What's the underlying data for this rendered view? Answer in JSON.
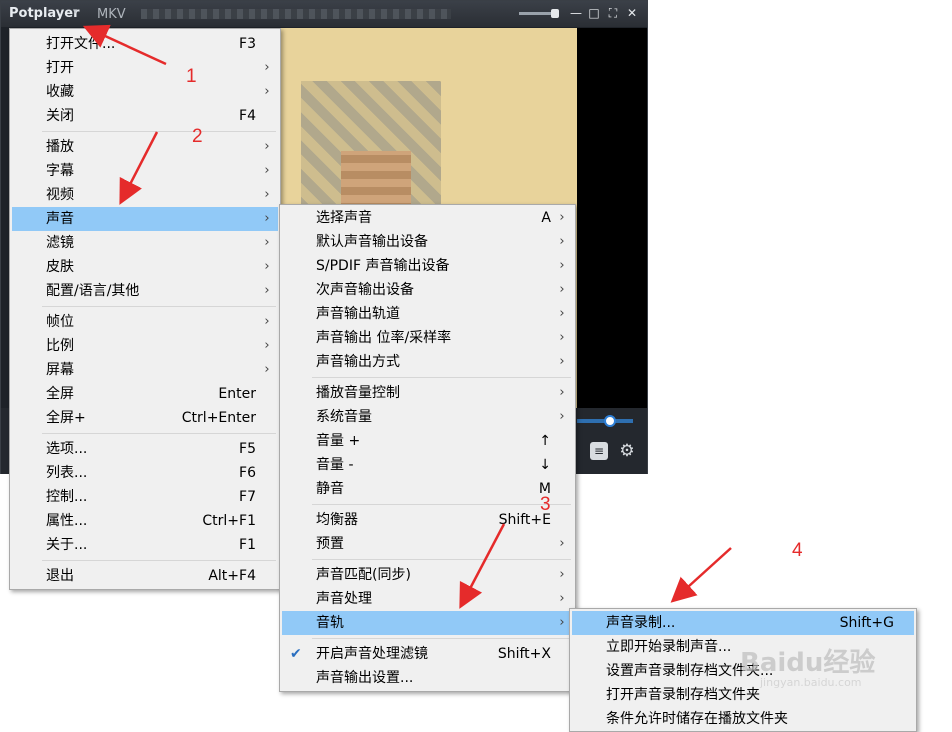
{
  "player": {
    "brand": "Potplayer",
    "format": "MKV",
    "window_buttons": [
      "—",
      "□",
      "⛶",
      "✕"
    ],
    "menu_caret": "▾"
  },
  "menu_main": {
    "items": [
      {
        "label": "打开文件...",
        "shortcut": "F3"
      },
      {
        "label": "打开",
        "submenu": true
      },
      {
        "label": "收藏",
        "submenu": true
      },
      {
        "label": "关闭",
        "shortcut": "F4"
      },
      {
        "label": "播放",
        "submenu": true
      },
      {
        "label": "字幕",
        "submenu": true
      },
      {
        "label": "视频",
        "submenu": true
      },
      {
        "label": "声音",
        "submenu": true,
        "highlighted": true
      },
      {
        "label": "滤镜",
        "submenu": true
      },
      {
        "label": "皮肤",
        "submenu": true
      },
      {
        "label": "配置/语言/其他",
        "submenu": true
      },
      {
        "label": "帧位",
        "submenu": true
      },
      {
        "label": "比例",
        "submenu": true
      },
      {
        "label": "屏幕",
        "submenu": true
      },
      {
        "label": "全屏",
        "shortcut": "Enter"
      },
      {
        "label": "全屏+",
        "shortcut": "Ctrl+Enter"
      },
      {
        "label": "选项...",
        "shortcut": "F5"
      },
      {
        "label": "列表...",
        "shortcut": "F6"
      },
      {
        "label": "控制...",
        "shortcut": "F7"
      },
      {
        "label": "属性...",
        "shortcut": "Ctrl+F1"
      },
      {
        "label": "关于...",
        "shortcut": "F1"
      },
      {
        "label": "退出",
        "shortcut": "Alt+F4"
      }
    ]
  },
  "menu_audio": {
    "items": [
      {
        "label": "选择声音",
        "shortcut": "A",
        "submenu": true
      },
      {
        "label": "默认声音输出设备",
        "submenu": true
      },
      {
        "label": "S/PDIF 声音输出设备",
        "submenu": true
      },
      {
        "label": "次声音输出设备",
        "submenu": true
      },
      {
        "label": "声音输出轨道",
        "submenu": true
      },
      {
        "label": "声音输出 位率/采样率",
        "submenu": true
      },
      {
        "label": "声音输出方式",
        "submenu": true
      },
      {
        "label": "播放音量控制",
        "submenu": true
      },
      {
        "label": "系统音量",
        "submenu": true
      },
      {
        "label": "音量 +",
        "shortcut": "↑"
      },
      {
        "label": "音量 -",
        "shortcut": "↓"
      },
      {
        "label": "静音",
        "shortcut": "M"
      },
      {
        "label": "均衡器",
        "shortcut": "Shift+E"
      },
      {
        "label": "预置",
        "submenu": true
      },
      {
        "label": "声音匹配(同步)",
        "submenu": true
      },
      {
        "label": "声音处理",
        "submenu": true
      },
      {
        "label": "音轨",
        "submenu": true,
        "highlighted": true
      },
      {
        "label": "开启声音处理滤镜",
        "shortcut": "Shift+X",
        "checked": true
      },
      {
        "label": "声音输出设置..."
      }
    ]
  },
  "menu_track": {
    "items": [
      {
        "label": "声音录制...",
        "shortcut": "Shift+G",
        "highlighted": true
      },
      {
        "label": "立即开始录制声音..."
      },
      {
        "label": "设置声音录制存档文件夹..."
      },
      {
        "label": "打开声音录制存档文件夹"
      },
      {
        "label": "条件允许时储存在播放文件夹"
      }
    ]
  },
  "annotations": [
    "1",
    "2",
    "3",
    "4"
  ],
  "watermark": {
    "text": "Baidu经验",
    "sub": "jingyan.baidu.com"
  },
  "colors": {
    "highlight": "#91c9f7",
    "menu_bg": "#f0f0f0",
    "annotation": "#e52b2b",
    "player_bg": "#1e2228"
  },
  "icons": [
    "chevron-right-icon",
    "check-icon",
    "list-icon",
    "gear-icon",
    "minimize-icon",
    "maximize-icon",
    "fullscreen-icon",
    "close-icon"
  ]
}
